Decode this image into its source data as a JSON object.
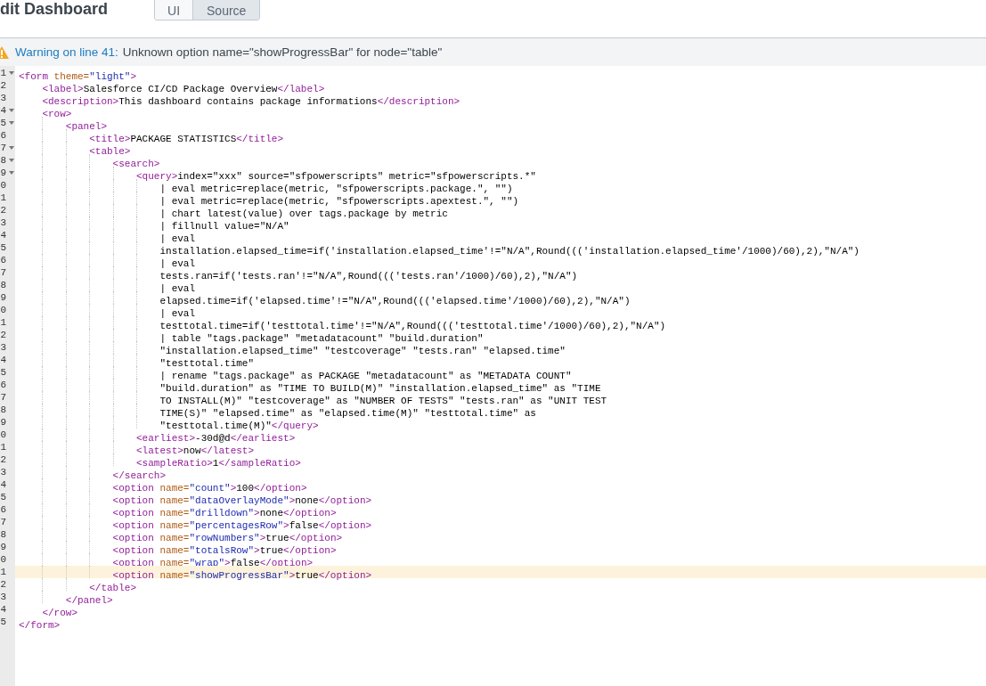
{
  "header": {
    "title": "dit Dashboard",
    "modes": [
      {
        "label": "UI",
        "selected": false
      },
      {
        "label": "Source",
        "selected": true
      }
    ]
  },
  "warning": {
    "label": "Warning on line 41:",
    "message": "Unknown option name=\"showProgressBar\" for node=\"table\""
  },
  "editor": {
    "lines": [
      {
        "num": "1",
        "fold": true,
        "highlighted": false,
        "parts": [
          {
            "kind": "tag",
            "text": "<form"
          },
          {
            "kind": "attr",
            "text": " theme="
          },
          {
            "kind": "value",
            "text": "\"light\""
          },
          {
            "kind": "tag",
            "text": ">"
          }
        ]
      },
      {
        "num": "2",
        "fold": false,
        "highlighted": false,
        "parts": [
          {
            "kind": "tag",
            "text": "    <label>"
          },
          {
            "kind": "text",
            "text": "Salesforce CI/CD Package Overview"
          },
          {
            "kind": "tag",
            "text": "</label>"
          }
        ]
      },
      {
        "num": "3",
        "fold": false,
        "highlighted": false,
        "parts": [
          {
            "kind": "tag",
            "text": "    <description>"
          },
          {
            "kind": "text",
            "text": "This dashboard contains package informations"
          },
          {
            "kind": "tag",
            "text": "</description>"
          }
        ]
      },
      {
        "num": "4",
        "fold": true,
        "highlighted": false,
        "parts": [
          {
            "kind": "tag",
            "text": "    <row>"
          }
        ]
      },
      {
        "num": "5",
        "fold": true,
        "highlighted": false,
        "parts": [
          {
            "kind": "tag",
            "text": "        <panel>"
          }
        ]
      },
      {
        "num": "6",
        "fold": false,
        "highlighted": false,
        "parts": [
          {
            "kind": "tag",
            "text": "            <title>"
          },
          {
            "kind": "text",
            "text": "PACKAGE STATISTICS"
          },
          {
            "kind": "tag",
            "text": "</title>"
          }
        ]
      },
      {
        "num": "7",
        "fold": true,
        "highlighted": false,
        "parts": [
          {
            "kind": "tag",
            "text": "            <table>"
          }
        ]
      },
      {
        "num": "8",
        "fold": true,
        "highlighted": false,
        "parts": [
          {
            "kind": "tag",
            "text": "                <search>"
          }
        ]
      },
      {
        "num": "9",
        "fold": true,
        "highlighted": false,
        "parts": [
          {
            "kind": "tag",
            "text": "                    <query>"
          },
          {
            "kind": "text",
            "text": "index=\"xxx\" source=\"sfpowerscripts\" metric=\"sfpowerscripts.*\""
          }
        ]
      },
      {
        "num": "0",
        "fold": false,
        "highlighted": false,
        "parts": [
          {
            "kind": "text",
            "text": "                        | eval metric=replace(metric, \"sfpowerscripts.package.\", \"\")"
          }
        ]
      },
      {
        "num": "1",
        "fold": false,
        "highlighted": false,
        "parts": [
          {
            "kind": "text",
            "text": "                        | eval metric=replace(metric, \"sfpowerscripts.apextest.\", \"\")"
          }
        ]
      },
      {
        "num": "2",
        "fold": false,
        "highlighted": false,
        "parts": [
          {
            "kind": "text",
            "text": "                        | chart latest(value) over tags.package by metric"
          }
        ]
      },
      {
        "num": "3",
        "fold": false,
        "highlighted": false,
        "parts": [
          {
            "kind": "text",
            "text": "                        | fillnull value=\"N/A\""
          }
        ]
      },
      {
        "num": "4",
        "fold": false,
        "highlighted": false,
        "parts": [
          {
            "kind": "text",
            "text": "                        | eval"
          }
        ]
      },
      {
        "num": "5",
        "fold": false,
        "highlighted": false,
        "parts": [
          {
            "kind": "text",
            "text": "                        installation.elapsed_time=if('installation.elapsed_time'!=\"N/A\",Round((('installation.elapsed_time'/1000)/60),2),\"N/A\")"
          }
        ]
      },
      {
        "num": "6",
        "fold": false,
        "highlighted": false,
        "parts": [
          {
            "kind": "text",
            "text": "                        | eval"
          }
        ]
      },
      {
        "num": "7",
        "fold": false,
        "highlighted": false,
        "parts": [
          {
            "kind": "text",
            "text": "                        tests.ran=if('tests.ran'!=\"N/A\",Round((('tests.ran'/1000)/60),2),\"N/A\")"
          }
        ]
      },
      {
        "num": "8",
        "fold": false,
        "highlighted": false,
        "parts": [
          {
            "kind": "text",
            "text": "                        | eval"
          }
        ]
      },
      {
        "num": "9",
        "fold": false,
        "highlighted": false,
        "parts": [
          {
            "kind": "text",
            "text": "                        elapsed.time=if('elapsed.time'!=\"N/A\",Round((('elapsed.time'/1000)/60),2),\"N/A\")"
          }
        ]
      },
      {
        "num": "0",
        "fold": false,
        "highlighted": false,
        "parts": [
          {
            "kind": "text",
            "text": "                        | eval"
          }
        ]
      },
      {
        "num": "1",
        "fold": false,
        "highlighted": false,
        "parts": [
          {
            "kind": "text",
            "text": "                        testtotal.time=if('testtotal.time'!=\"N/A\",Round((('testtotal.time'/1000)/60),2),\"N/A\")"
          }
        ]
      },
      {
        "num": "2",
        "fold": false,
        "highlighted": false,
        "parts": [
          {
            "kind": "text",
            "text": "                        | table \"tags.package\" \"metadatacount\" \"build.duration\""
          }
        ]
      },
      {
        "num": "3",
        "fold": false,
        "highlighted": false,
        "parts": [
          {
            "kind": "text",
            "text": "                        \"installation.elapsed_time\" \"testcoverage\" \"tests.ran\" \"elapsed.time\""
          }
        ]
      },
      {
        "num": "4",
        "fold": false,
        "highlighted": false,
        "parts": [
          {
            "kind": "text",
            "text": "                        \"testtotal.time\""
          }
        ]
      },
      {
        "num": "5",
        "fold": false,
        "highlighted": false,
        "parts": [
          {
            "kind": "text",
            "text": "                        | rename \"tags.package\" as PACKAGE \"metadatacount\" as \"METADATA COUNT\""
          }
        ]
      },
      {
        "num": "6",
        "fold": false,
        "highlighted": false,
        "parts": [
          {
            "kind": "text",
            "text": "                        \"build.duration\" as \"TIME TO BUILD(M)\" \"installation.elapsed_time\" as \"TIME"
          }
        ]
      },
      {
        "num": "7",
        "fold": false,
        "highlighted": false,
        "parts": [
          {
            "kind": "text",
            "text": "                        TO INSTALL(M)\" \"testcoverage\" as \"NUMBER OF TESTS\" \"tests.ran\" as \"UNIT TEST"
          }
        ]
      },
      {
        "num": "8",
        "fold": false,
        "highlighted": false,
        "parts": [
          {
            "kind": "text",
            "text": "                        TIME(S)\" \"elapsed.time\" as \"elapsed.time(M)\" \"testtotal.time\" as"
          }
        ]
      },
      {
        "num": "9",
        "fold": false,
        "highlighted": false,
        "parts": [
          {
            "kind": "text",
            "text": "                        \"testtotal.time(M)\""
          },
          {
            "kind": "tag",
            "text": "</query>"
          }
        ]
      },
      {
        "num": "0",
        "fold": false,
        "highlighted": false,
        "parts": [
          {
            "kind": "tag",
            "text": "                    <earliest>"
          },
          {
            "kind": "text",
            "text": "-30d@d"
          },
          {
            "kind": "tag",
            "text": "</earliest>"
          }
        ]
      },
      {
        "num": "1",
        "fold": false,
        "highlighted": false,
        "parts": [
          {
            "kind": "tag",
            "text": "                    <latest>"
          },
          {
            "kind": "text",
            "text": "now"
          },
          {
            "kind": "tag",
            "text": "</latest>"
          }
        ]
      },
      {
        "num": "2",
        "fold": false,
        "highlighted": false,
        "parts": [
          {
            "kind": "tag",
            "text": "                    <sampleRatio>"
          },
          {
            "kind": "text",
            "text": "1"
          },
          {
            "kind": "tag",
            "text": "</sampleRatio>"
          }
        ]
      },
      {
        "num": "3",
        "fold": false,
        "highlighted": false,
        "parts": [
          {
            "kind": "tag",
            "text": "                </search>"
          }
        ]
      },
      {
        "num": "4",
        "fold": false,
        "highlighted": false,
        "parts": [
          {
            "kind": "tag",
            "text": "                <option"
          },
          {
            "kind": "attr",
            "text": " name="
          },
          {
            "kind": "value",
            "text": "\"count\""
          },
          {
            "kind": "tag",
            "text": ">"
          },
          {
            "kind": "text",
            "text": "100"
          },
          {
            "kind": "tag",
            "text": "</option>"
          }
        ]
      },
      {
        "num": "5",
        "fold": false,
        "highlighted": false,
        "parts": [
          {
            "kind": "tag",
            "text": "                <option"
          },
          {
            "kind": "attr",
            "text": " name="
          },
          {
            "kind": "value",
            "text": "\"dataOverlayMode\""
          },
          {
            "kind": "tag",
            "text": ">"
          },
          {
            "kind": "text",
            "text": "none"
          },
          {
            "kind": "tag",
            "text": "</option>"
          }
        ]
      },
      {
        "num": "6",
        "fold": false,
        "highlighted": false,
        "parts": [
          {
            "kind": "tag",
            "text": "                <option"
          },
          {
            "kind": "attr",
            "text": " name="
          },
          {
            "kind": "value",
            "text": "\"drilldown\""
          },
          {
            "kind": "tag",
            "text": ">"
          },
          {
            "kind": "text",
            "text": "none"
          },
          {
            "kind": "tag",
            "text": "</option>"
          }
        ]
      },
      {
        "num": "7",
        "fold": false,
        "highlighted": false,
        "parts": [
          {
            "kind": "tag",
            "text": "                <option"
          },
          {
            "kind": "attr",
            "text": " name="
          },
          {
            "kind": "value",
            "text": "\"percentagesRow\""
          },
          {
            "kind": "tag",
            "text": ">"
          },
          {
            "kind": "text",
            "text": "false"
          },
          {
            "kind": "tag",
            "text": "</option>"
          }
        ]
      },
      {
        "num": "8",
        "fold": false,
        "highlighted": false,
        "parts": [
          {
            "kind": "tag",
            "text": "                <option"
          },
          {
            "kind": "attr",
            "text": " name="
          },
          {
            "kind": "value",
            "text": "\"rowNumbers\""
          },
          {
            "kind": "tag",
            "text": ">"
          },
          {
            "kind": "text",
            "text": "true"
          },
          {
            "kind": "tag",
            "text": "</option>"
          }
        ]
      },
      {
        "num": "9",
        "fold": false,
        "highlighted": false,
        "parts": [
          {
            "kind": "tag",
            "text": "                <option"
          },
          {
            "kind": "attr",
            "text": " name="
          },
          {
            "kind": "value",
            "text": "\"totalsRow\""
          },
          {
            "kind": "tag",
            "text": ">"
          },
          {
            "kind": "text",
            "text": "true"
          },
          {
            "kind": "tag",
            "text": "</option>"
          }
        ]
      },
      {
        "num": "0",
        "fold": false,
        "highlighted": false,
        "parts": [
          {
            "kind": "tag",
            "text": "                <option"
          },
          {
            "kind": "attr",
            "text": " name="
          },
          {
            "kind": "value",
            "text": "\"wrap\""
          },
          {
            "kind": "tag",
            "text": ">"
          },
          {
            "kind": "text",
            "text": "false"
          },
          {
            "kind": "tag",
            "text": "</option>"
          }
        ]
      },
      {
        "num": "1",
        "fold": false,
        "highlighted": true,
        "parts": [
          {
            "kind": "tag",
            "text": "                <option"
          },
          {
            "kind": "attr",
            "text": " name="
          },
          {
            "kind": "value",
            "text": "\"showProgressBar\""
          },
          {
            "kind": "tag",
            "text": ">"
          },
          {
            "kind": "text",
            "text": "true"
          },
          {
            "kind": "tag",
            "text": "</option>"
          }
        ]
      },
      {
        "num": "2",
        "fold": false,
        "highlighted": false,
        "parts": [
          {
            "kind": "tag",
            "text": "            </table>"
          }
        ]
      },
      {
        "num": "3",
        "fold": false,
        "highlighted": false,
        "parts": [
          {
            "kind": "tag",
            "text": "        </panel>"
          }
        ]
      },
      {
        "num": "4",
        "fold": false,
        "highlighted": false,
        "parts": [
          {
            "kind": "tag",
            "text": "    </row>"
          }
        ]
      },
      {
        "num": "5",
        "fold": false,
        "highlighted": false,
        "parts": [
          {
            "kind": "tag",
            "text": "</form>"
          }
        ]
      }
    ]
  }
}
